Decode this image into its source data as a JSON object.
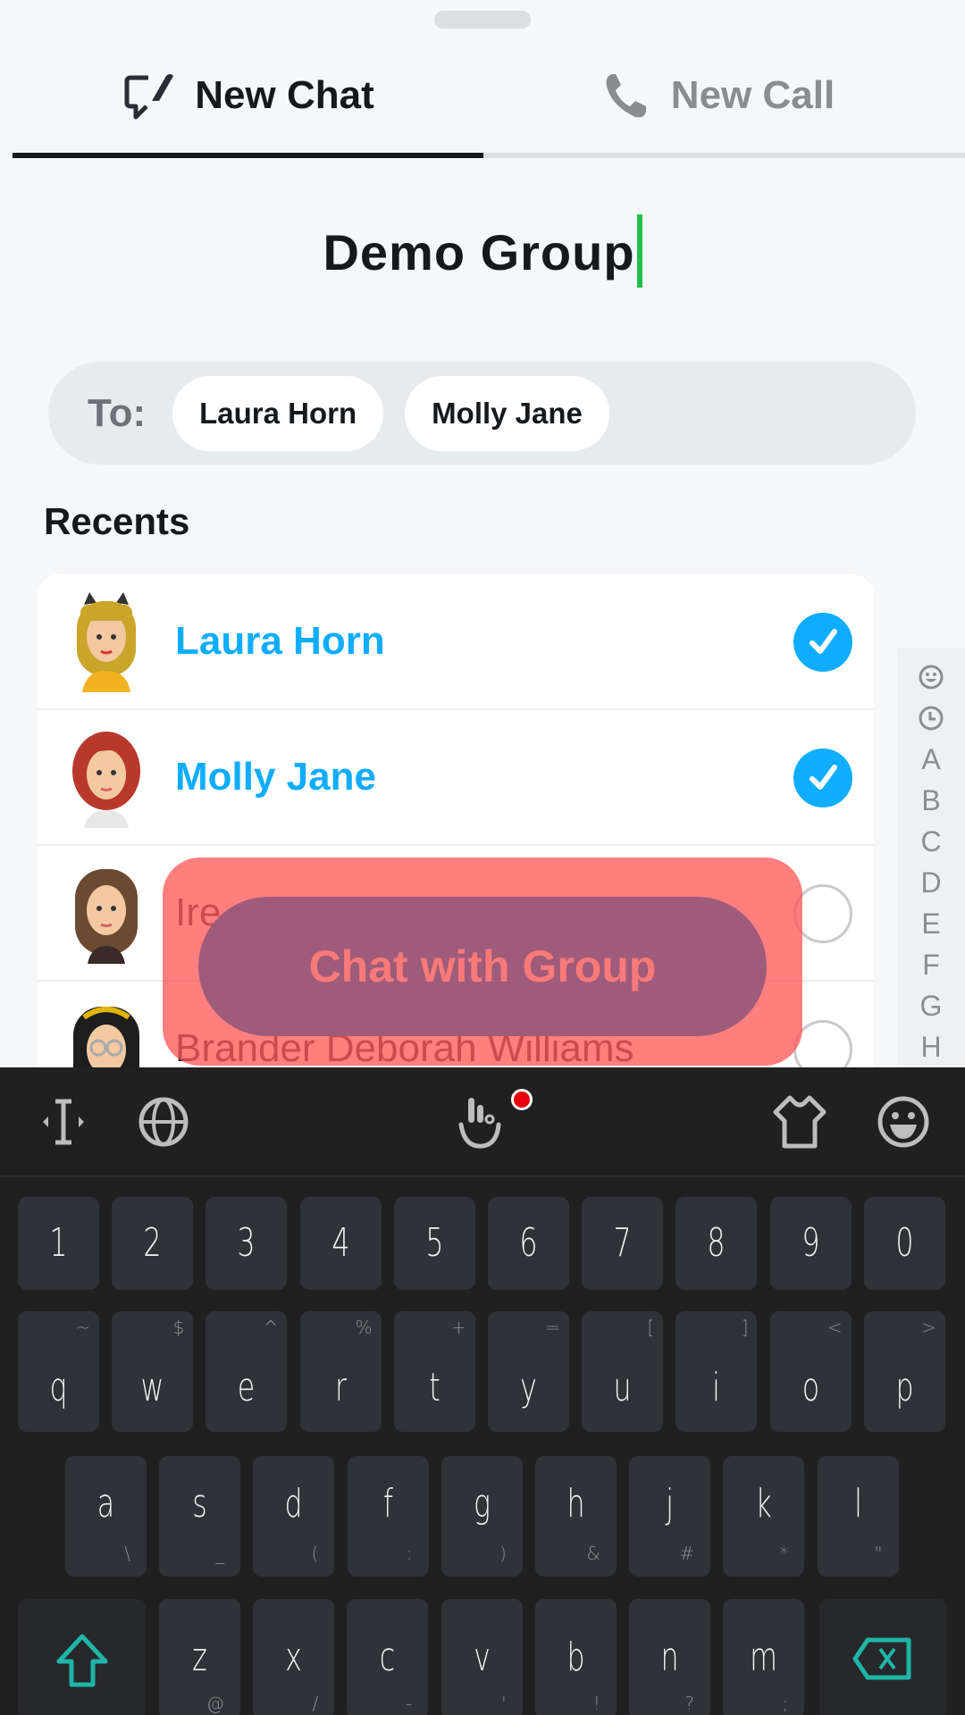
{
  "tabs": [
    {
      "label": "New Chat",
      "icon": "new-chat-icon",
      "active": true
    },
    {
      "label": "New Call",
      "icon": "phone-icon",
      "active": false
    }
  ],
  "group_name": "Demo Group",
  "to_field": {
    "label": "To:",
    "recipients": [
      "Laura Horn",
      "Molly Jane"
    ]
  },
  "recents": {
    "heading": "Recents",
    "contacts": [
      {
        "name": "Laura Horn",
        "selected": true
      },
      {
        "name": "Molly Jane",
        "selected": true
      },
      {
        "name": "Ire",
        "selected": false
      },
      {
        "name": "Brander Deborah Williams",
        "selected": false
      }
    ]
  },
  "alpha_index": [
    "smiley-icon",
    "clock-icon",
    "A",
    "B",
    "C",
    "D",
    "E",
    "F",
    "G",
    "H"
  ],
  "primary_action": {
    "label": "Chat with Group"
  },
  "colors": {
    "accent": "#0fadff",
    "caret": "#1fc04c",
    "highlight": "#ff5a5a",
    "keyboard_accent": "#1fb5a7"
  },
  "keyboard": {
    "toolbar": [
      "cursor-icon",
      "globe-icon",
      "gesture-icon",
      "theme-shirt-icon",
      "emoji-icon"
    ],
    "rows": {
      "numbers": [
        {
          "main": "1"
        },
        {
          "main": "2"
        },
        {
          "main": "3"
        },
        {
          "main": "4"
        },
        {
          "main": "5"
        },
        {
          "main": "6"
        },
        {
          "main": "7"
        },
        {
          "main": "8"
        },
        {
          "main": "9"
        },
        {
          "main": "0"
        }
      ],
      "top": [
        {
          "main": "q",
          "sub": "~"
        },
        {
          "main": "w",
          "sub": "$"
        },
        {
          "main": "e",
          "sub": "^"
        },
        {
          "main": "r",
          "sub": "%"
        },
        {
          "main": "t",
          "sub": "+"
        },
        {
          "main": "y",
          "sub": "="
        },
        {
          "main": "u",
          "sub": "["
        },
        {
          "main": "i",
          "sub": "]"
        },
        {
          "main": "o",
          "sub": "<"
        },
        {
          "main": "p",
          "sub": ">"
        }
      ],
      "middle": [
        {
          "main": "a",
          "sub": "\\"
        },
        {
          "main": "s",
          "sub": "_"
        },
        {
          "main": "d",
          "sub": "("
        },
        {
          "main": "f",
          "sub": ":"
        },
        {
          "main": "g",
          "sub": ")"
        },
        {
          "main": "h",
          "sub": "&"
        },
        {
          "main": "j",
          "sub": "#"
        },
        {
          "main": "k",
          "sub": "*"
        },
        {
          "main": "l",
          "sub": "\""
        }
      ],
      "bottom": [
        {
          "main": "z",
          "sub": "@"
        },
        {
          "main": "x",
          "sub": "/"
        },
        {
          "main": "c",
          "sub": "-"
        },
        {
          "main": "v",
          "sub": "'"
        },
        {
          "main": "b",
          "sub": "!"
        },
        {
          "main": "n",
          "sub": "?"
        },
        {
          "main": "m",
          "sub": ";"
        }
      ]
    }
  }
}
